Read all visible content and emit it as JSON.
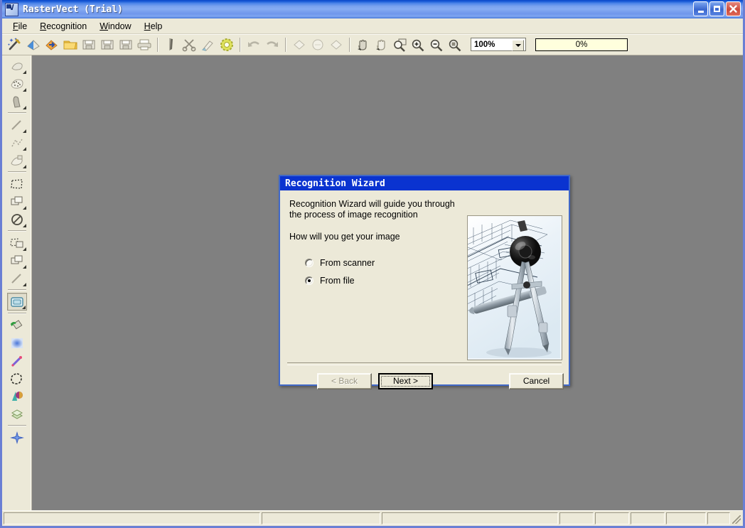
{
  "window": {
    "title": "RasterVect (Trial)",
    "app_icon": "rastervect-icon",
    "caption": {
      "minimize": "minimize-button",
      "maximize": "maximize-button",
      "close": "close-button"
    }
  },
  "menubar": {
    "items": [
      {
        "label": "File",
        "accel": "F"
      },
      {
        "label": "Recognition",
        "accel": "R"
      },
      {
        "label": "Window",
        "accel": "W"
      },
      {
        "label": "Help",
        "accel": "H"
      }
    ]
  },
  "toolbar": {
    "buttons": [
      {
        "name": "recognition-wizard-icon",
        "glyph": "magic-wand"
      },
      {
        "name": "import-raster-icon",
        "glyph": "blue-drop"
      },
      {
        "name": "export-vector-icon",
        "glyph": "orange-arrow"
      },
      {
        "name": "open-file-icon",
        "glyph": "folder"
      },
      {
        "name": "save-icon",
        "glyph": "disk"
      },
      {
        "name": "save-as-icon",
        "glyph": "disk-2"
      },
      {
        "name": "save-all-icon",
        "glyph": "disk-3"
      },
      {
        "name": "print-icon",
        "glyph": "printer"
      },
      {
        "name": "cut-raster-icon",
        "glyph": "ribbon"
      },
      {
        "name": "scissors-icon",
        "glyph": "scissors"
      },
      {
        "name": "clean-icon",
        "glyph": "brush"
      },
      {
        "name": "despeckle-icon",
        "glyph": "gear-green"
      },
      {
        "name": "undo-icon",
        "glyph": "undo-arrow"
      },
      {
        "name": "redo-icon",
        "glyph": "redo-arrow"
      },
      {
        "name": "rotate-left-icon",
        "glyph": "rot-left"
      },
      {
        "name": "deskew-icon",
        "glyph": "deskew"
      },
      {
        "name": "rotate-right-icon",
        "glyph": "rot-right"
      },
      {
        "name": "pan-icon",
        "glyph": "hand-dark"
      },
      {
        "name": "pan-light-icon",
        "glyph": "hand-light"
      },
      {
        "name": "zoom-window-icon",
        "glyph": "zoom-rect"
      },
      {
        "name": "zoom-in-icon",
        "glyph": "zoom-plus"
      },
      {
        "name": "zoom-out-icon",
        "glyph": "zoom-minus"
      },
      {
        "name": "zoom-fit-icon",
        "glyph": "zoom-fit"
      }
    ],
    "zoom": {
      "value": "100%",
      "name": "zoom-level-combo"
    },
    "progress": {
      "value": "0%",
      "name": "progress-bar"
    }
  },
  "left_toolbar": {
    "buttons": [
      {
        "name": "tool-select-raster",
        "glyph": "raster-select"
      },
      {
        "name": "tool-select-halftone",
        "glyph": "halftone"
      },
      {
        "name": "tool-airbrush",
        "glyph": "airbrush"
      },
      {
        "name": "tool-line",
        "glyph": "line"
      },
      {
        "name": "tool-polyline",
        "glyph": "polyline"
      },
      {
        "name": "tool-eraser-area",
        "glyph": "eraser-area"
      },
      {
        "name": "tool-rect-select",
        "glyph": "rect-dashed"
      },
      {
        "name": "tool-copy-region",
        "glyph": "copy-region"
      },
      {
        "name": "tool-forbid",
        "glyph": "no-entry"
      },
      {
        "name": "tool-move-region",
        "glyph": "move-region"
      },
      {
        "name": "tool-duplicate",
        "glyph": "duplicate"
      },
      {
        "name": "tool-line-2",
        "glyph": "line-2"
      },
      {
        "name": "tool-frame-select",
        "glyph": "frame-select"
      },
      {
        "name": "tool-fill-bucket",
        "glyph": "paint-bucket"
      },
      {
        "name": "tool-gradient",
        "glyph": "gradient-square"
      },
      {
        "name": "tool-pencil",
        "glyph": "pencil"
      },
      {
        "name": "tool-lasso",
        "glyph": "lasso"
      },
      {
        "name": "tool-color-picker",
        "glyph": "color-cone"
      },
      {
        "name": "tool-layers",
        "glyph": "layers"
      },
      {
        "name": "tool-snap",
        "glyph": "snap-star"
      }
    ]
  },
  "statusbar": {
    "panels": [
      "",
      "",
      "",
      "",
      "",
      "",
      ""
    ]
  },
  "dialog": {
    "title": "Recognition Wizard",
    "paragraph_1": "Recognition Wizard will guide you through the process of image recognition",
    "paragraph_2": "How will you get your image",
    "picture_name": "blueprint-compass-image",
    "options": [
      {
        "label": "From scanner",
        "checked": false,
        "name": "radio-from-scanner"
      },
      {
        "label": "From file",
        "checked": true,
        "name": "radio-from-file"
      }
    ],
    "buttons": {
      "back": "< Back",
      "next": "Next >",
      "cancel": "Cancel"
    }
  },
  "colors": {
    "window_frame": "#6a7fd4",
    "titlebar_blue": "#4d85e8",
    "dialog_titlebar": "#0a33d0",
    "face": "#ece9d8",
    "canvas": "#808080",
    "progress_bg": "#ffffdd"
  }
}
